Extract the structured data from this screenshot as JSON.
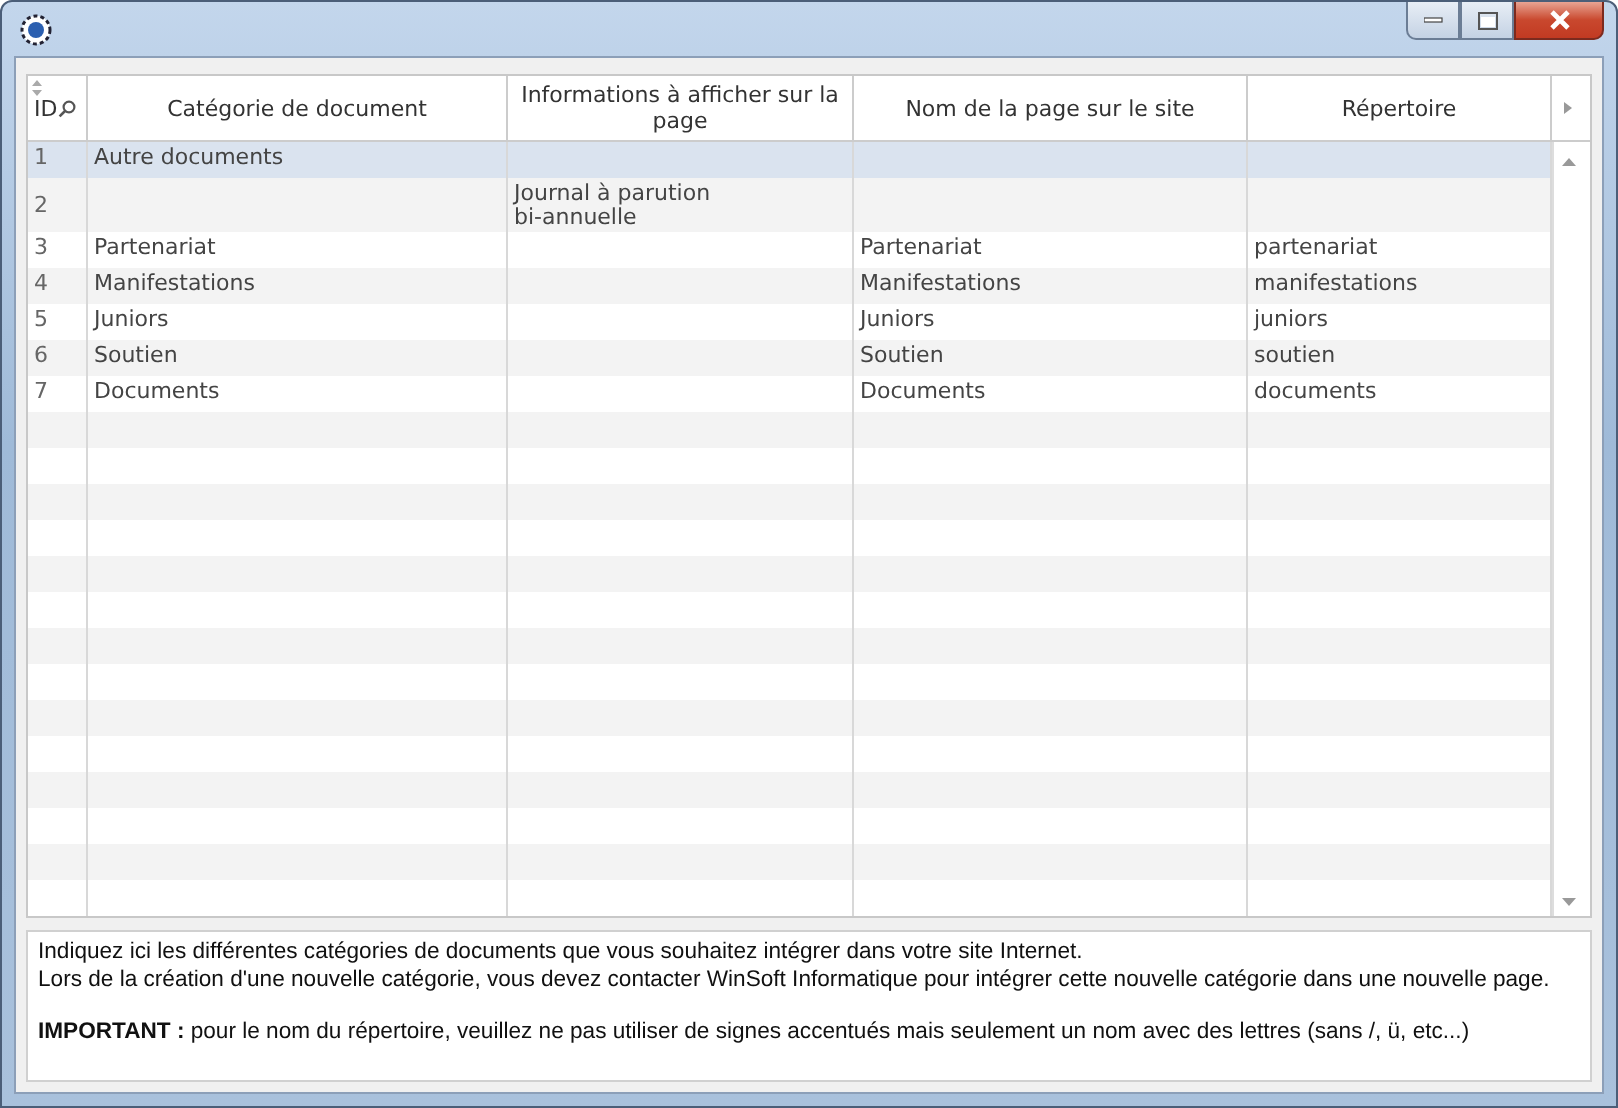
{
  "table": {
    "columns": [
      "ID",
      "Catégorie de document",
      "Informations à afficher sur la page",
      "Nom de la page sur le site",
      "Répertoire"
    ],
    "rows": [
      {
        "id": "1",
        "category": "Autre documents",
        "info": "",
        "page": "",
        "folder": "",
        "selected": true
      },
      {
        "id": "2",
        "category": "",
        "info": "Journal à parution\nbi-annuelle",
        "page": "",
        "folder": "",
        "selected": false
      },
      {
        "id": "3",
        "category": "Partenariat",
        "info": "",
        "page": "Partenariat",
        "folder": "partenariat",
        "selected": false
      },
      {
        "id": "4",
        "category": "Manifestations",
        "info": "",
        "page": "Manifestations",
        "folder": "manifestations",
        "selected": false
      },
      {
        "id": "5",
        "category": "Juniors",
        "info": "",
        "page": "Juniors",
        "folder": "juniors",
        "selected": false
      },
      {
        "id": "6",
        "category": "Soutien",
        "info": "",
        "page": "Soutien",
        "folder": "soutien",
        "selected": false
      },
      {
        "id": "7",
        "category": "Documents",
        "info": "",
        "page": "Documents",
        "folder": "documents",
        "selected": false
      }
    ]
  },
  "notes": [
    "Indiquez ici les différentes catégories de documents que vous souhaitez intégrer dans votre site Internet.",
    "Lors de la création d'une nouvelle catégorie, vous devez contacter WinSoft Informatique pour intégrer cette nouvelle catégorie dans une nouvelle page.",
    "**IMPORTANT :** pour le nom du répertoire, veuillez ne pas utiliser de signes accentués mais seulement un nom avec des lettres (sans /, ü, etc...)"
  ]
}
